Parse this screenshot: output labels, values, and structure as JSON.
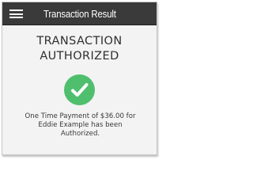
{
  "header": {
    "title": "Transaction Result",
    "menu_icon": "hamburger-menu-icon"
  },
  "result": {
    "heading_line1": "TRANSACTION",
    "heading_line2": "AUTHORIZED",
    "status_icon": "checkmark-icon",
    "status_color": "#4fbf6e",
    "message_line1": "One Time Payment of $36.00 for",
    "message_line2": "Eddie Example has been",
    "message_line3": "Authorized."
  },
  "colors": {
    "header_bg": "#3a3a3a",
    "page_bg": "#f3f3f3",
    "heading_text": "#2f2f2f"
  }
}
